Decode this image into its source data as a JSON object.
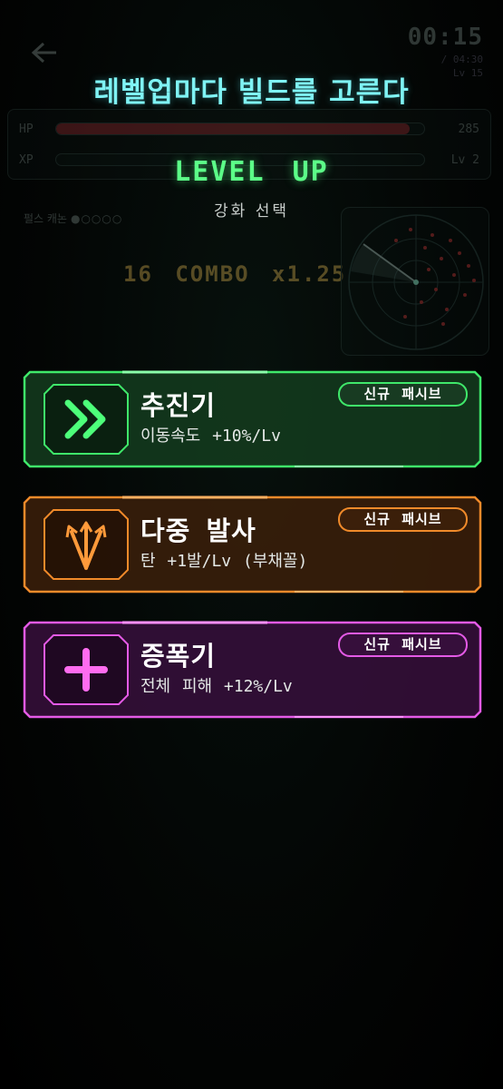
{
  "banner": "레벨업마다 빌드를 고른다",
  "hud": {
    "timer": "00:15",
    "sub_timer_1": "/ 04:30",
    "sub_timer_2": "Lv 15",
    "hp_label": "HP",
    "hp_value": "285",
    "hp_fill": 0.96,
    "xp_label": "XP",
    "xp_value": "Lv 2",
    "xp_fill": 0.0,
    "pulse_label": "펄스 캐논",
    "pulse_dots": "●○○○○",
    "combo": "16 COMBO  x1.25"
  },
  "level_up": {
    "title": "LEVEL UP",
    "subtitle": "강화 선택"
  },
  "cards": [
    {
      "name": "추진기",
      "desc": "이동속도 +10%/Lv",
      "tag": "신규 패시브",
      "color": "#3fe86a",
      "icon": "double-chevron-right-icon"
    },
    {
      "name": "다중 발사",
      "desc": "탄 +1발/Lv (부채꼴)",
      "tag": "신규 패시브",
      "color": "#f08a2a",
      "icon": "spread-shot-icon"
    },
    {
      "name": "증폭기",
      "desc": "전체 피해 +12%/Lv",
      "tag": "신규 패시브",
      "color": "#e45ae6",
      "icon": "plus-icon"
    }
  ]
}
